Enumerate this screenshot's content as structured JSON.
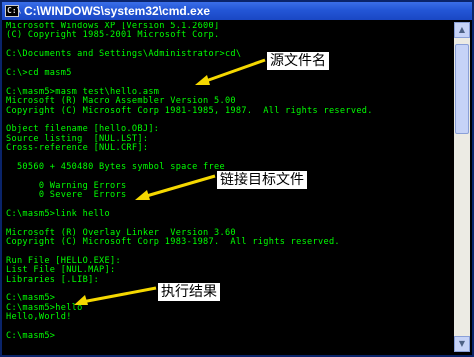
{
  "window": {
    "title": "C:\\WINDOWS\\system32\\cmd.exe",
    "icon_text": "C:\\"
  },
  "console": {
    "lines": [
      "Microsoft Windows XP [Version 5.1.2600]",
      "(C) Copyright 1985-2001 Microsoft Corp.",
      "",
      "C:\\Documents and Settings\\Administrator>cd\\",
      "",
      "C:\\>cd masm5",
      "",
      "C:\\masm5>masm test\\hello.asm",
      "Microsoft (R) Macro Assembler Version 5.00",
      "Copyright (C) Microsoft Corp 1981-1985, 1987.  All rights reserved.",
      "",
      "Object filename [hello.OBJ]:",
      "Source listing  [NUL.LST]:",
      "Cross-reference [NUL.CRF]:",
      "",
      "  50560 + 450480 Bytes symbol space free",
      "",
      "      0 Warning Errors",
      "      0 Severe  Errors",
      "",
      "C:\\masm5>link hello",
      "",
      "Microsoft (R) Overlay Linker  Version 3.60",
      "Copyright (C) Microsoft Corp 1983-1987.  All rights reserved.",
      "",
      "Run File [HELLO.EXE]:",
      "List File [NUL.MAP]:",
      "Libraries [.LIB]:",
      "",
      "C:\\masm5>",
      "C:\\masm5>hello",
      "Hello,World!",
      "",
      "C:\\masm5>"
    ]
  },
  "annotations": {
    "source_file": "源文件名",
    "link_target": "链接目标文件",
    "run_result": "执行结果"
  },
  "colors": {
    "console_text": "#00ff00",
    "console_bg": "#000000",
    "arrow": "#f5d800",
    "titlebar": "#2356d6"
  }
}
